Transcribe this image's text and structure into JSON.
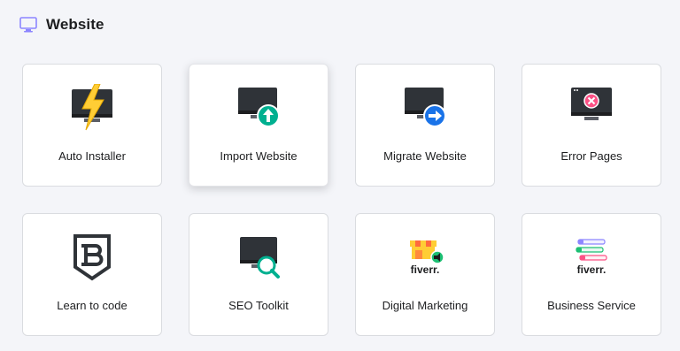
{
  "header": {
    "title": "Website",
    "icon": "monitor-icon"
  },
  "cards": [
    {
      "label": "Auto Installer",
      "icon": "lightning-monitor-icon"
    },
    {
      "label": "Import Website",
      "icon": "upload-monitor-icon"
    },
    {
      "label": "Migrate Website",
      "icon": "migrate-monitor-icon"
    },
    {
      "label": "Error Pages",
      "icon": "error-monitor-icon"
    },
    {
      "label": "Learn to code",
      "icon": "code-shield-icon"
    },
    {
      "label": "SEO Toolkit",
      "icon": "seo-monitor-icon"
    },
    {
      "label": "Digital Marketing",
      "icon": "fiverr-marketing-icon",
      "brand": "fiverr."
    },
    {
      "label": "Business Service",
      "icon": "fiverr-business-icon",
      "brand": "fiverr."
    }
  ],
  "colors": {
    "green": "#00b090",
    "blue": "#1a73e8",
    "red": "#fc5185",
    "yellow": "#ffcd35",
    "dark": "#2f3338",
    "fiverr_green": "#1dbf73"
  }
}
